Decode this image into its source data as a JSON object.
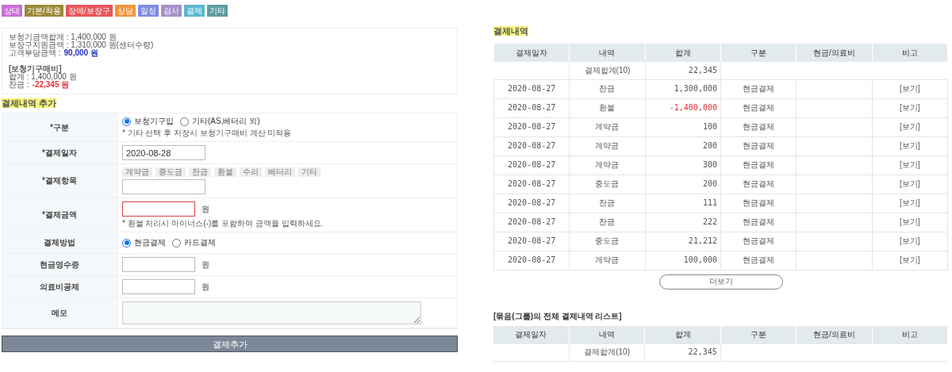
{
  "category_tags": [
    {
      "label": "상태",
      "color": "#c86dd7"
    },
    {
      "label": "기본/착용",
      "color": "#9b8a3a"
    },
    {
      "label": "장애/보장구",
      "color": "#e8555a"
    },
    {
      "label": "상담",
      "color": "#f0953a"
    },
    {
      "label": "일정",
      "color": "#7b8de0"
    },
    {
      "label": "검사",
      "color": "#a58fca"
    },
    {
      "label": "결제",
      "color": "#5bb8d0"
    },
    {
      "label": "기타",
      "color": "#5f9ea0"
    }
  ],
  "summary": {
    "lines": [
      {
        "kind": "plain",
        "text": "보청기금액합계 : 1,400,000 원"
      },
      {
        "kind": "plain",
        "text": "보장구지원금액 : 1,310,000 원(센터수령)"
      },
      {
        "kind": "value",
        "text": "고객부담금액 :",
        "value": "90,000 원",
        "color": "#2233bb"
      },
      {
        "kind": "gap"
      },
      {
        "kind": "heading",
        "text": "[보청기구매비]"
      },
      {
        "kind": "plain",
        "text": "합계 : 1,400,000 원"
      },
      {
        "kind": "value",
        "text": "잔금 :",
        "value": "-22,345 원",
        "color": "#e0303a"
      }
    ]
  },
  "form": {
    "title": "결제내역 추가",
    "rows": [
      {
        "kind": "radio",
        "label": "*구분",
        "options": [
          {
            "label": "보청기구입",
            "selected": true
          },
          {
            "label": "기타(AS,베터리 외)",
            "selected": false
          }
        ],
        "note": "* 기타 선택 후 저장시 보청기구매비 계산 미적용"
      },
      {
        "kind": "input",
        "label": "*결제일자",
        "value": "2020-08-28"
      },
      {
        "kind": "chips",
        "label": "*결제항목",
        "chips": [
          "계약금",
          "중도금",
          "잔금",
          "환불",
          "수리",
          "베터리",
          "기타"
        ]
      },
      {
        "kind": "input",
        "label": "*결제금액",
        "invalid": true,
        "unit": "원",
        "note": "* 환불 처리시 마이너스(-)를 포함하여 금액을 입력하세요."
      },
      {
        "kind": "radio",
        "label": "결제방법",
        "options": [
          {
            "label": "현금결제",
            "selected": true
          },
          {
            "label": "카드결제",
            "selected": false
          }
        ]
      },
      {
        "kind": "input",
        "label": "현금영수증",
        "invalid": false,
        "unit": "원"
      },
      {
        "kind": "input",
        "label": "의료비공제",
        "invalid": false,
        "unit": "원"
      },
      {
        "kind": "textarea",
        "label": "메모"
      }
    ],
    "submit": "결제추가"
  },
  "payments": {
    "title": "결제내역",
    "columns": [
      "결제일자",
      "내역",
      "합계",
      "구분",
      "현금/의료비",
      "비고"
    ],
    "total": {
      "label": "결제합계(10)",
      "amount": "22,345"
    },
    "rows": [
      {
        "date": "2020-08-27",
        "item": "잔금",
        "amount": "1,300,000",
        "negative": false,
        "method": "현금결제",
        "link": "[보기]"
      },
      {
        "date": "2020-08-27",
        "item": "환불",
        "amount": "-1,400,000",
        "negative": true,
        "method": "현금결제",
        "link": "[보기]"
      },
      {
        "date": "2020-08-27",
        "item": "계약금",
        "amount": "100",
        "negative": false,
        "method": "현금결제",
        "link": "[보기]"
      },
      {
        "date": "2020-08-27",
        "item": "계약금",
        "amount": "200",
        "negative": false,
        "method": "현금결제",
        "link": "[보기]"
      },
      {
        "date": "2020-08-27",
        "item": "계약금",
        "amount": "300",
        "negative": false,
        "method": "현금결제",
        "link": "[보기]"
      },
      {
        "date": "2020-08-27",
        "item": "중도금",
        "amount": "200",
        "negative": false,
        "method": "현금결제",
        "link": "[보기]"
      },
      {
        "date": "2020-08-27",
        "item": "잔금",
        "amount": "111",
        "negative": false,
        "method": "현금결제",
        "link": "[보기]"
      },
      {
        "date": "2020-08-27",
        "item": "잔금",
        "amount": "222",
        "negative": false,
        "method": "현금결제",
        "link": "[보기]"
      },
      {
        "date": "2020-08-27",
        "item": "중도금",
        "amount": "21,212",
        "negative": false,
        "method": "현금결제",
        "link": "[보기]"
      },
      {
        "date": "2020-08-27",
        "item": "계약금",
        "amount": "100,000",
        "negative": false,
        "method": "현금결제",
        "link": "[보기]"
      }
    ],
    "more": "더보기"
  },
  "group_payments": {
    "title": "[묶음(그룹)의 전체 결제내역 리스트]",
    "columns": [
      "결제일자",
      "내역",
      "합계",
      "구분",
      "현금/의료비",
      "비고"
    ],
    "total": {
      "label": "결제합계(10)",
      "amount": "22,345"
    }
  }
}
